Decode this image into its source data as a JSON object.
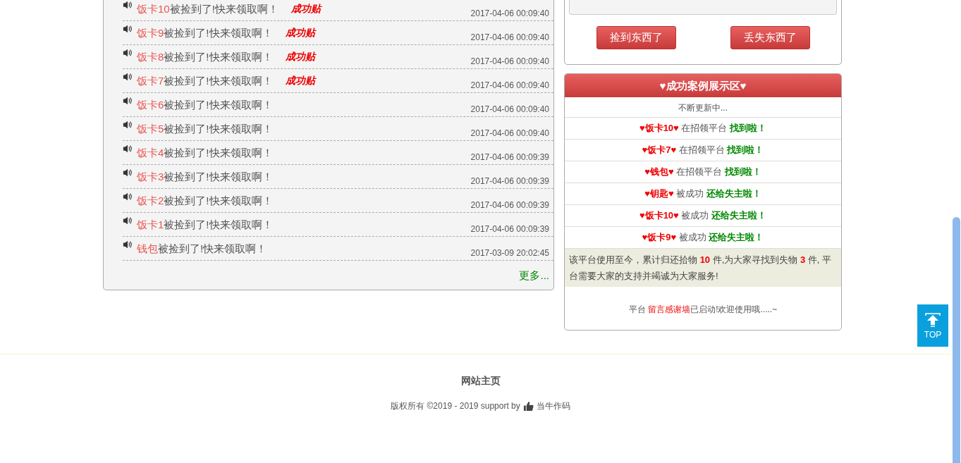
{
  "lost_list": {
    "rows": [
      {
        "item": "饭卡10",
        "text": "被捡到了!快来领取啊！",
        "tag": "成功贴",
        "time": "2017-04-06 00:09:40"
      },
      {
        "item": "饭卡9",
        "text": "被捡到了!快来领取啊！",
        "tag": "成功贴",
        "time": "2017-04-06 00:09:40"
      },
      {
        "item": "饭卡8",
        "text": "被捡到了!快来领取啊！",
        "tag": "成功贴",
        "time": "2017-04-06 00:09:40"
      },
      {
        "item": "饭卡7",
        "text": "被捡到了!快来领取啊！",
        "tag": "成功贴",
        "time": "2017-04-06 00:09:40"
      },
      {
        "item": "饭卡6",
        "text": "被捡到了!快来领取啊！",
        "time": "2017-04-06 00:09:40"
      },
      {
        "item": "饭卡5",
        "text": "被捡到了!快来领取啊！",
        "time": "2017-04-06 00:09:40"
      },
      {
        "item": "饭卡4",
        "text": "被捡到了!快来领取啊！",
        "time": "2017-04-06 00:09:39"
      },
      {
        "item": "饭卡3",
        "text": "被捡到了!快来领取啊！",
        "time": "2017-04-06 00:09:39"
      },
      {
        "item": "饭卡2",
        "text": "被捡到了!快来领取啊！",
        "time": "2017-04-06 00:09:39"
      },
      {
        "item": "饭卡1",
        "text": "被捡到了!快来领取啊！",
        "time": "2017-04-06 00:09:39"
      },
      {
        "item": "钱包",
        "text": "被捡到了!快来领取啊！",
        "time": "2017-03-09 20:02:45"
      }
    ],
    "more": "更多..."
  },
  "actions": {
    "buttons": [
      "捡到东西了",
      "丢失东西了"
    ]
  },
  "cases": {
    "title": "♥成功案例展示区♥",
    "subtitle": "不断更新中...",
    "items": [
      {
        "item": "♥饭卡10♥",
        "text": "在招领平台",
        "status": "找到啦！"
      },
      {
        "item": "♥饭卡7♥",
        "text": "在招领平台",
        "status": "找到啦！"
      },
      {
        "item": "♥钱包♥",
        "text": "在招领平台",
        "status": "找到啦！"
      },
      {
        "item": "♥钥匙♥",
        "text": "被成功",
        "status": "还给失主啦！"
      },
      {
        "item": "♥饭卡10♥",
        "text": "被成功",
        "status": "还给失主啦！"
      },
      {
        "item": "♥饭卡9♥",
        "text": "被成功",
        "status": "还给失主啦！"
      }
    ],
    "stats": "该平台使用至今，累计归还拾物 **10** 件,为大家寻找到失物 **3** 件, 平台需要大家的支持并竭诚为大家服务!",
    "note": {
      "prefix": "平台 ",
      "link": "留言感谢墙",
      "suffix": "已启动!欢迎使用哦.....~"
    }
  },
  "footer": {
    "title": "网站主页",
    "copyright": "版权所有 ©2019 - 2019 support by",
    "author": "当牛作码"
  },
  "top_button": "TOP"
}
